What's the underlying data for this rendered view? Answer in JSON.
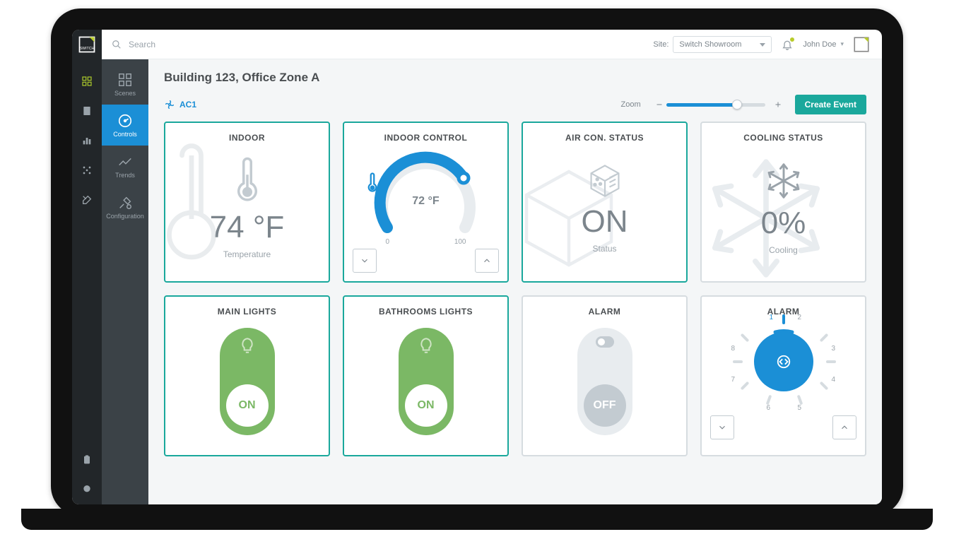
{
  "header": {
    "search_placeholder": "Search",
    "site_label": "Site:",
    "site_selected": "Switch Showroom",
    "user_name": "John Doe"
  },
  "sidebar_secondary": {
    "items": [
      {
        "label": "Scenes"
      },
      {
        "label": "Controls"
      },
      {
        "label": "Trends"
      },
      {
        "label": "Configuration"
      }
    ],
    "active_index": 1
  },
  "page": {
    "title": "Building 123, Office Zone A",
    "device": "AC1",
    "zoom_label": "Zoom",
    "zoom_percent": 72,
    "create_button": "Create Event"
  },
  "cards": {
    "indoor": {
      "title": "INDOOR",
      "value": "74 °F",
      "sub": "Temperature"
    },
    "indoor_control": {
      "title": "INDOOR CONTROL",
      "value": "72 °F",
      "min": "0",
      "max": "100"
    },
    "ac_status": {
      "title": "AIR CON. STATUS",
      "value": "ON",
      "sub": "Status"
    },
    "cooling": {
      "title": "COOLING STATUS",
      "value": "0%",
      "sub": "Cooling"
    },
    "main_lights": {
      "title": "MAIN LIGHTS",
      "state": "ON"
    },
    "bath_lights": {
      "title": "BATHROOMS LIGHTS",
      "state": "ON"
    },
    "alarm_toggle": {
      "title": "ALARM",
      "state": "OFF"
    },
    "alarm_dial": {
      "title": "ALARM",
      "positions": [
        "1",
        "2",
        "3",
        "4",
        "5",
        "6",
        "7",
        "8"
      ],
      "selected": 1
    }
  }
}
